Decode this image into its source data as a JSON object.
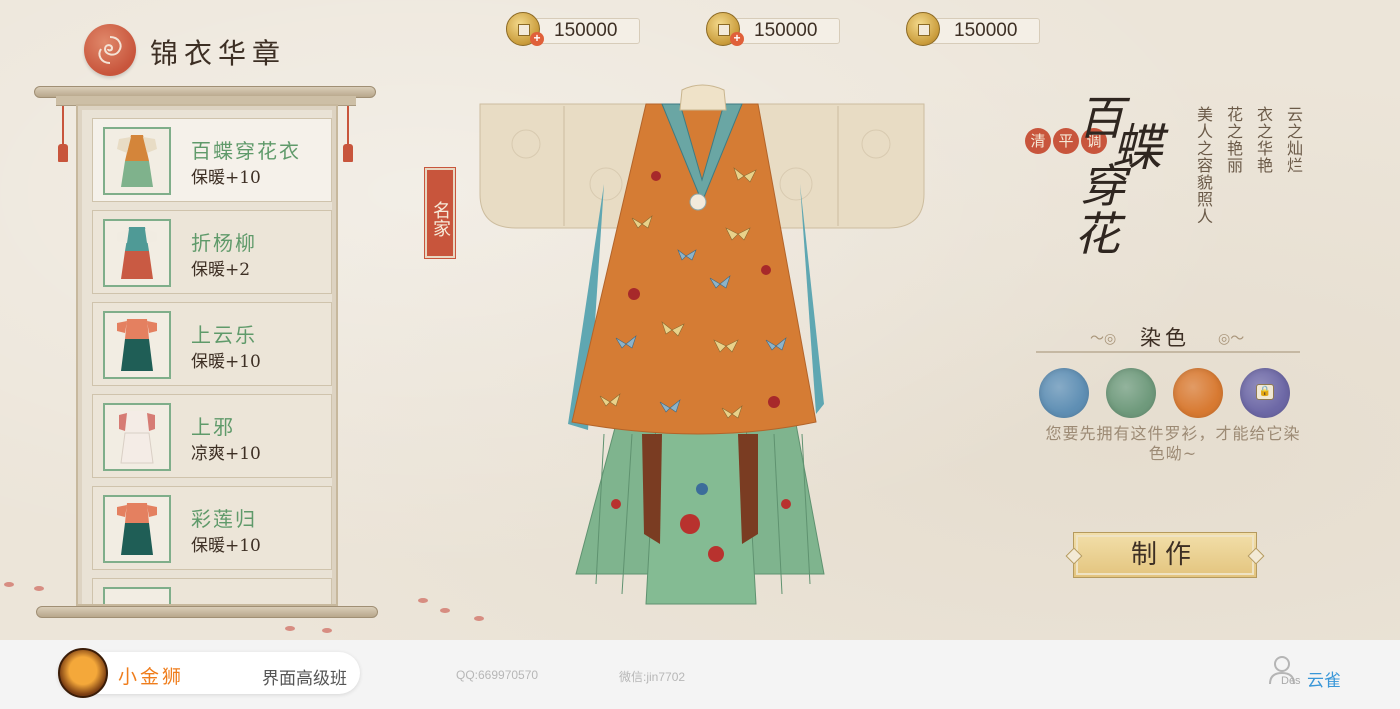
{
  "app": {
    "title": "锦衣华章"
  },
  "currency": [
    {
      "amount": "150000",
      "has_add": true,
      "icon": "copper-coin-icon"
    },
    {
      "amount": "150000",
      "has_add": true,
      "icon": "copper-coin-icon"
    },
    {
      "amount": "150000",
      "has_add": false,
      "icon": "copper-coin-icon"
    }
  ],
  "wardrobe": {
    "items": [
      {
        "name": "百蝶穿花衣",
        "stat": "保暖+10",
        "selected": true
      },
      {
        "name": "折杨柳",
        "stat": "保暖+2",
        "selected": false
      },
      {
        "name": "上云乐",
        "stat": "保暖+10",
        "selected": false
      },
      {
        "name": "上邪",
        "stat": "凉爽+10",
        "selected": false
      },
      {
        "name": "彩莲归",
        "stat": "保暖+10",
        "selected": false
      }
    ]
  },
  "garment": {
    "badge": "名家",
    "title_tags": [
      "清",
      "平",
      "调"
    ],
    "big_title": [
      "百",
      "蝶",
      "穿",
      "花"
    ],
    "poem_columns": [
      "云之灿烂",
      "衣之华艳",
      "花之艳丽",
      "美人之容貌照人"
    ]
  },
  "dye": {
    "title": "染色",
    "swatches": [
      {
        "color": "#5f8fb4",
        "locked": false
      },
      {
        "color": "#6f9a7c",
        "locked": false
      },
      {
        "color": "#d87a32",
        "locked": false
      },
      {
        "color": "#6d68a6",
        "locked": true
      }
    ],
    "hint": "您要先拥有这件罗衫，才能给它染色呦~"
  },
  "actions": {
    "make_label": "制作"
  },
  "footer": {
    "brand_name": "小金狮",
    "course": "界面高级班",
    "qq": "QQ:669970570",
    "wechat": "微信:jin7702",
    "user_label": "Des",
    "user_name": "云雀"
  },
  "colors": {
    "accent_red": "#c8553c",
    "item_green": "#5f9a6a",
    "gold_button": "#e3c47e",
    "brand_orange": "#ef7d1c",
    "user_blue": "#3a97d8"
  }
}
